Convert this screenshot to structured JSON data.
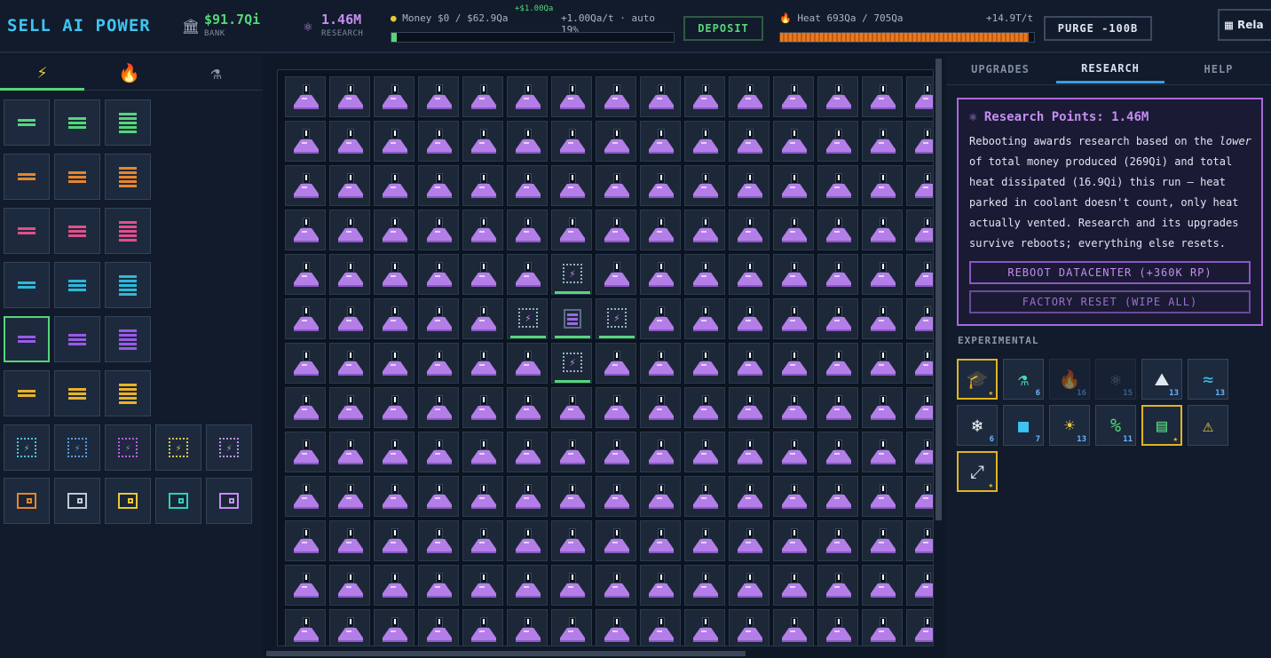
{
  "header": {
    "logo": "SELL AI POWER",
    "bank_value": "$91.7Qi",
    "bank_label": "BANK",
    "research_value": "1.46M",
    "research_label": "RESEARCH",
    "money_text": "Money $0 / $62.9Qa",
    "money_float": "+$1.00Qa",
    "money_rate": "+1.00Qa/t · auto 19%",
    "money_fill": 0.02,
    "deposit_label": "DEPOSIT",
    "heat_text": "Heat 693Qa / 705Qa",
    "heat_rate": "+14.9T/t",
    "heat_fill": 0.98,
    "purge_label": "PURGE -100B",
    "map_label": "Rela"
  },
  "left_tabs": [
    {
      "name": "power",
      "icon": "⚡",
      "active": true
    },
    {
      "name": "heat",
      "icon": "🔥",
      "active": false
    },
    {
      "name": "research",
      "icon": "⚗",
      "active": false
    }
  ],
  "colors": {
    "accent": "#55d67a",
    "cyan": "#3fc4f0",
    "purple": "#c48ef0",
    "gold": "#e0b422",
    "heat": "#e87a1e"
  },
  "parts": {
    "stack_rows": [
      {
        "color": "#55d67a"
      },
      {
        "color": "#e8852a"
      },
      {
        "color": "#e0508a"
      },
      {
        "color": "#2fb8d8"
      },
      {
        "color": "#9a5ae8"
      },
      {
        "color": "#e8b22a"
      }
    ],
    "cell_colors": [
      "#4ac8d8",
      "#5a9ae8",
      "#c45ae8",
      "#e8c83a",
      "#c48ef0"
    ],
    "vent_colors": [
      "#e8852a",
      "#c0c8d6",
      "#e8c83a",
      "#2fd0b8",
      "#c48ef0"
    ]
  },
  "grid": {
    "cols": 15,
    "rows": 13,
    "specials": [
      {
        "r": 4,
        "c": 6,
        "kind": "cell"
      },
      {
        "r": 5,
        "c": 5,
        "kind": "cell"
      },
      {
        "r": 5,
        "c": 6,
        "kind": "stack"
      },
      {
        "r": 5,
        "c": 7,
        "kind": "cell"
      },
      {
        "r": 6,
        "c": 6,
        "kind": "cell"
      }
    ]
  },
  "right_tabs": [
    "UPGRADES",
    "RESEARCH",
    "HELP"
  ],
  "research": {
    "title": "Research Points: 1.46M",
    "desc_parts": [
      "Rebooting awards research based on the ",
      "lower",
      " of total money produced (269Qi) and total heat dissipated (16.9Qi) this run — heat parked in coolant doesn't count, only heat actually vented. Research and its upgrades survive reboots; everything else resets."
    ],
    "reboot_label": "REBOOT DATACENTER (+360K RP)",
    "reset_label": "FACTORY RESET (WIPE ALL)"
  },
  "experimental": {
    "label": "EXPERIMENTAL",
    "items": [
      {
        "icon": "🎓",
        "level": "★",
        "gold": true,
        "dim": false
      },
      {
        "icon": "⚗",
        "level": "6",
        "gold": false,
        "dim": false
      },
      {
        "icon": "🔥",
        "level": "16",
        "gold": false,
        "dim": true
      },
      {
        "icon": "⚛",
        "level": "15",
        "gold": false,
        "dim": true
      },
      {
        "icon": "⛰",
        "level": "13",
        "gold": false,
        "dim": false
      },
      {
        "icon": "≈",
        "level": "13",
        "gold": false,
        "dim": false
      },
      {
        "icon": "❄",
        "level": "6",
        "gold": false,
        "dim": false
      },
      {
        "icon": "■",
        "level": "7",
        "gold": false,
        "dim": false
      },
      {
        "icon": "☀",
        "level": "13",
        "gold": false,
        "dim": false
      },
      {
        "icon": "%",
        "level": "11",
        "gold": false,
        "dim": false
      },
      {
        "icon": "▤",
        "level": "★",
        "gold": true,
        "dim": false
      },
      {
        "icon": "⚠",
        "level": "",
        "gold": false,
        "dim": false
      },
      {
        "icon": "⤢",
        "level": "★",
        "gold": true,
        "dim": false
      }
    ]
  }
}
